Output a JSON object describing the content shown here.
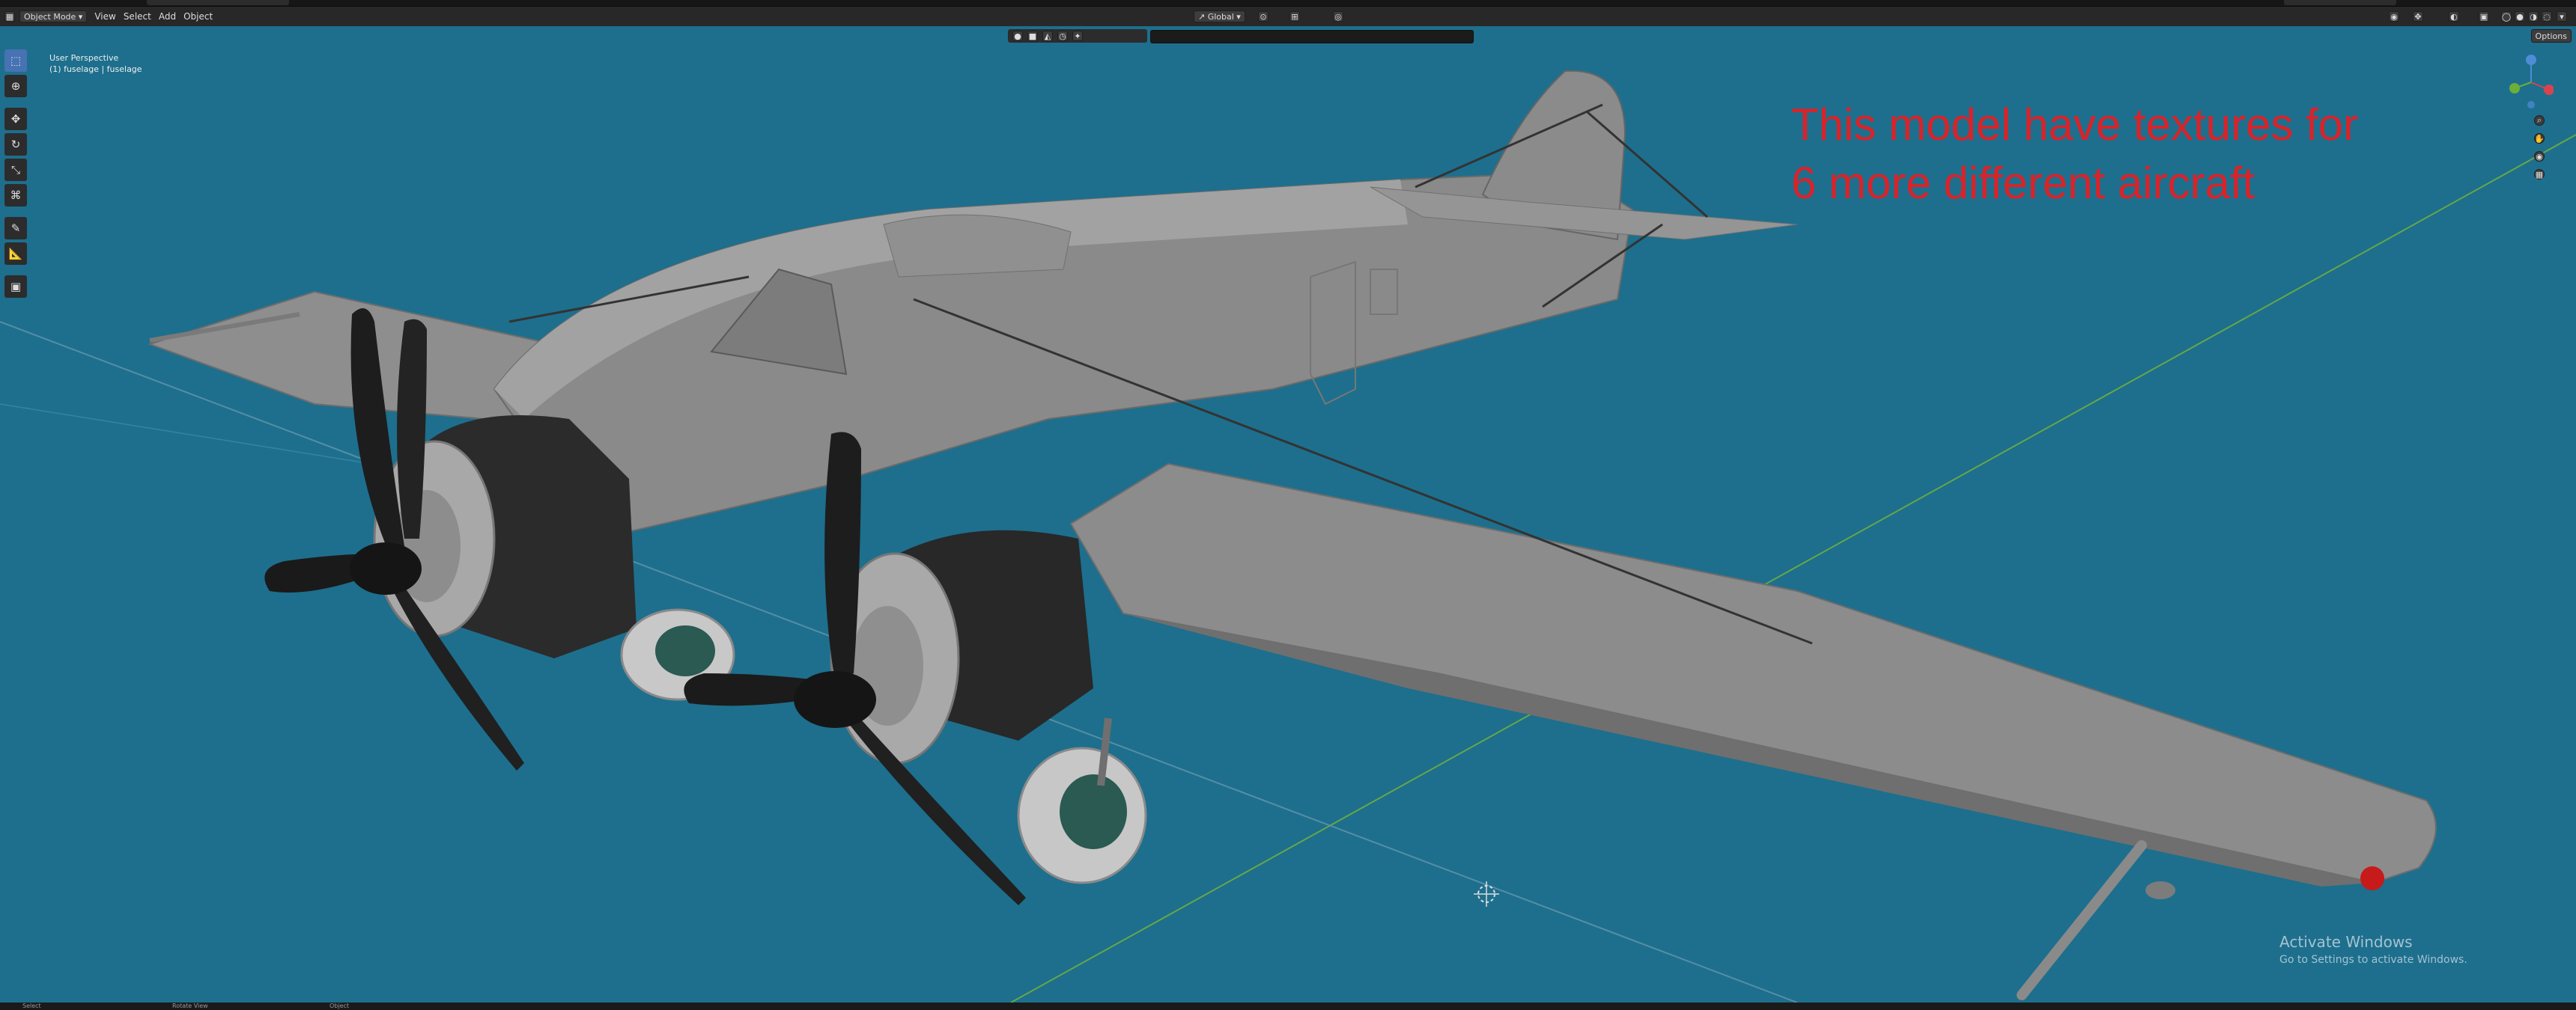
{
  "header": {
    "mode": "Object Mode",
    "menus": [
      "View",
      "Select",
      "Add",
      "Object"
    ],
    "transform_orientation": "Global"
  },
  "viewport": {
    "perspective_label": "User Perspective",
    "object_label": "(1) fuselage | fuselage",
    "options_label": "Options",
    "overlay_text_line1": "This model have textures for",
    "overlay_text_line2": "6 more different aircraft"
  },
  "tools": [
    "select-box-icon",
    "cursor-icon",
    "move-icon",
    "rotate-icon",
    "scale-icon",
    "transform-icon",
    "annotate-icon",
    "measure-icon",
    "add-cube-icon"
  ],
  "watermark": {
    "title": "Activate Windows",
    "subtitle": "Go to Settings to activate Windows."
  },
  "statusbar": {
    "left": "Select",
    "middle": "Rotate View",
    "right": "Object"
  },
  "colors": {
    "viewport_bg": "#1d6f8d",
    "overlay_text": "#d8232a",
    "header_bg": "#282828"
  }
}
